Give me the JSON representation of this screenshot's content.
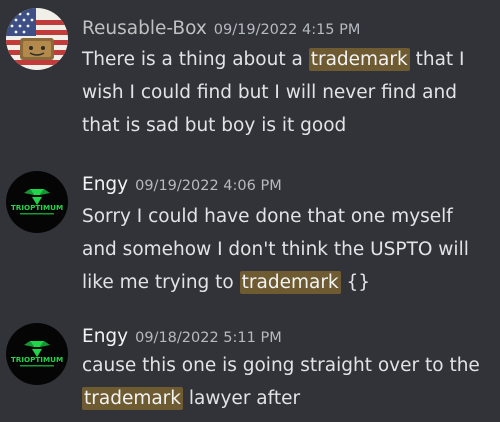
{
  "messages": [
    {
      "author": "Reusable-Box",
      "timestamp": "09/19/2022 4:15 PM",
      "avatar_icon": "usa-flag-avatar-icon",
      "parts": [
        {
          "text": "There is a thing about a ",
          "highlight": false
        },
        {
          "text": "trademark",
          "highlight": true
        },
        {
          "text": " that I wish I could find but I will never find and that is sad but boy is it good",
          "highlight": false
        }
      ]
    },
    {
      "author": "Engy",
      "timestamp": "09/19/2022 4:06 PM",
      "avatar_icon": "trioptimum-logo-avatar-icon",
      "avatar_text": "TRIOPTIMUM",
      "parts": [
        {
          "text": "Sorry I could have done that one myself and somehow I don't think the USPTO will like me trying to ",
          "highlight": false
        },
        {
          "text": "trademark",
          "highlight": true
        },
        {
          "text": " {}",
          "highlight": false
        }
      ]
    },
    {
      "author": "Engy",
      "timestamp": "09/18/2022 5:11 PM",
      "avatar_icon": "trioptimum-logo-avatar-icon",
      "avatar_text": "TRIOPTIMUM",
      "parts": [
        {
          "text": "cause this one is going straight over to the ",
          "highlight": false
        },
        {
          "text": "trademark",
          "highlight": true
        },
        {
          "text": " lawyer after",
          "highlight": false
        }
      ]
    }
  ],
  "colors": {
    "background": "#313338",
    "highlight": "#6e5b32",
    "trioptimum_green": "#22d44a"
  }
}
